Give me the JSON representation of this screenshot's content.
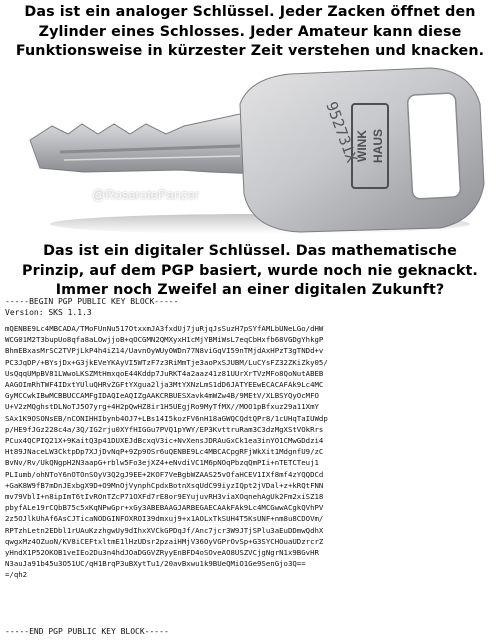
{
  "headline_top": [
    "Das ist ein analoger Schlüssel. Jeder Zacken öffnet den",
    "Zylinder eines Schlosses. Jeder Amateur kann diese",
    "Funktionsweise in kürzester Zeit verstehen und knacken."
  ],
  "key_image": {
    "watermark": "@RosarotePanzer",
    "brand_text": "WINK HAUS",
    "serial": "952731X"
  },
  "headline_mid": [
    "Das ist ein digitaler Schlüssel. Das mathematische",
    "Prinzip, auf dem PGP basiert, wurde noch nie geknackt.",
    "Immer noch Zweifel an einer digitalen Zukunft?"
  ],
  "pgp": {
    "begin": "-----BEGIN PGP PUBLIC KEY BLOCK-----",
    "version": "Version: SKS 1.1.3",
    "body": "mQENBE9Lc4MBCADA/TMoFUnNu517OtxxmJA3fxdUj7juRjqJsSuzH7pSYfAMLbUNeLGo/dHW\nWCG01M2T3bupUo8qfa8aLOwjjoB+qOCGMN2QMXyxH1cMjYBMiWsL7eqCbHxfb68VGDgYhkgP\nBhmEBxasMrSC2TVPjLkP4h4iZ14/UavnOyWUyOWDn77N8viGqVI59nTMjdAxHPzT3gTNDd+v\nPC3JqDP/+BYsjDx+G3jkEVeYKAyVI5WTzF7z3RiMmTje3aoPxSJUBM/LuCYsFZ32ZKiZky05/\nUsQqqUMpBV81LWwoLKSZMtHmxqoE44Kddp7JuRKT4a2aaz41z81UUrXrTVzMFo8QoNutABEB\nAAGOImRhTWF4IDxtYUluQHRvZGFtYXgua2lja3MtYXNzLmS1dD6JATYEEwECACAFAk9Lc4MC\nGyMCCwkIBwMCBBUCCAMFgIDAQIeAQIZgAAKCRBUESXavk4mWZw4B/9MEtV/XLBSYQyOcMFO\nU+V2zMQghstDLNoTJ5O7yrg+4H2pQwHZ8ir1H5UEgjRo9MyTfMX//MOO1pBfxuz29a11XmY\nSAx1K9OSONsEB/nCONIHHIbynb4OJ7+LBs14I5kozFV6nH18aGWQCQdtQPr8/1cUHqTaIUWdp\np/HE9fJGz228c4a/3Q/IG2rju0XYfHIGGu7PVQ1pYWY/EP3KvttruRam3C3dzMgXStVOkRrs\nPCux4QCPIQ21X+9KaitQ3p41DUXEJdBcxqV3ic+NvXensJDRAuGxCk1ea3inYO1CMwGDdzi4\nHt89JNaceLW3CktpDp7XJjDvNqP+9Zp9OSr6uQENBE9Lc4MBCACpgRFjWkXit1MdgnfU9/zC\nBvNv/Rv/UkQNgpH2N3aapG+rblw5Fo3ejXZ4+eNvdiVC1M6pNOqPbzqQmPIi+nTETCTeuj1\nPLIumb/ohNToY6nOTOnSOyV3Q2gJ9EE+2KOF7VeBgbWZAAS25vOfaHCEV1IXf8mf4zYQQDCd\n+GaK8W9fB7mDnJExbgX9D+O9MnOjVynphCpdxBotnXsqUdC99iyzIQpt2jVDal+z+kRQtFNN\nmv79VblI+n8ipImT6tIvROnTZcP71OXFd7rE8or9EYujuvRH3viaXOqnehAgUk2Fm2xiSZ18\npbyfALe19rCQbB75c5xKqNPwGpr+xGy3ABEBAAGJARBEGAECAAkFAk9Lc4MCGwwACgkQVhPV\n2z5OJlkUhAf6AsCJTicaNODGINFOXROI39dmxuj9+x1AOLxTkSUH4T5KsUNF+nm8u8CDOVm/\nRPTzhLetn2EDbl1rUAuKzzhgwUy9dIhxXVCkGPDqJf/Anc7jcr3W9JTjSPlu3aEuDDmwQdhX\nqwgxMz4OZuoN/KV8iCEFtxltmE1lHzUDsr2pzaiHMjV36OyVGPrOvSp+G3SYCHOuaUDzrcrZ\nyHndX1P52OKOB1veIEo2Du3n4hdJOaDGGVZRyyEnBFD4oSOveAO8USZVCjgNgrN1x9BGvHR\nN3auJa91b45u3O51UC/qH1BrqP3uBXytTu1/20avBxwu1k9BUeQMiO1Ge9SenGjo3Q==\n=/qh2",
    "end": "-----END PGP PUBLIC KEY BLOCK-----"
  }
}
